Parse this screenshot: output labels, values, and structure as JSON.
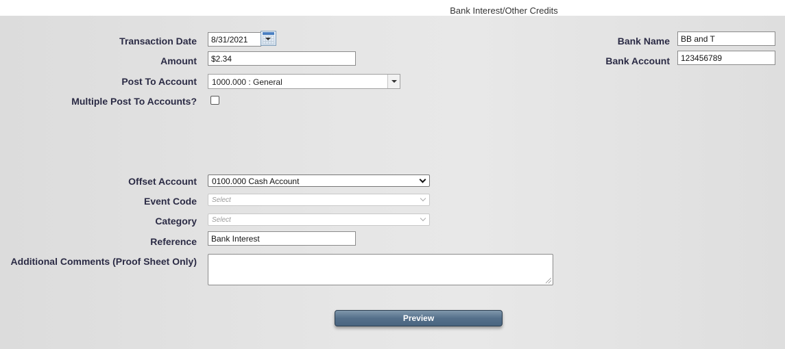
{
  "page": {
    "title": "Bank Interest/Other Credits"
  },
  "form": {
    "transaction_date": {
      "label": "Transaction Date",
      "value": "8/31/2021"
    },
    "amount": {
      "label": "Amount",
      "value": "$2.34"
    },
    "post_to_account": {
      "label": "Post To Account",
      "value": "1000.000 : General"
    },
    "multiple_post": {
      "label": "Multiple Post To Accounts?",
      "checked": false
    },
    "offset_account": {
      "label": "Offset Account",
      "value": "0100.000 Cash Account"
    },
    "event_code": {
      "label": "Event Code",
      "placeholder": "Select"
    },
    "category": {
      "label": "Category",
      "placeholder": "Select"
    },
    "reference": {
      "label": "Reference",
      "value": "Bank Interest"
    },
    "additional_comments": {
      "label": "Additional Comments (Proof Sheet Only)",
      "value": ""
    }
  },
  "bank": {
    "name": {
      "label": "Bank Name",
      "value": "BB and T"
    },
    "account": {
      "label": "Bank Account",
      "value": "123456789"
    }
  },
  "actions": {
    "preview_label": "Preview"
  },
  "icons": {
    "date_picker": "calendar-icon",
    "dropdown": "chevron-down-icon"
  }
}
